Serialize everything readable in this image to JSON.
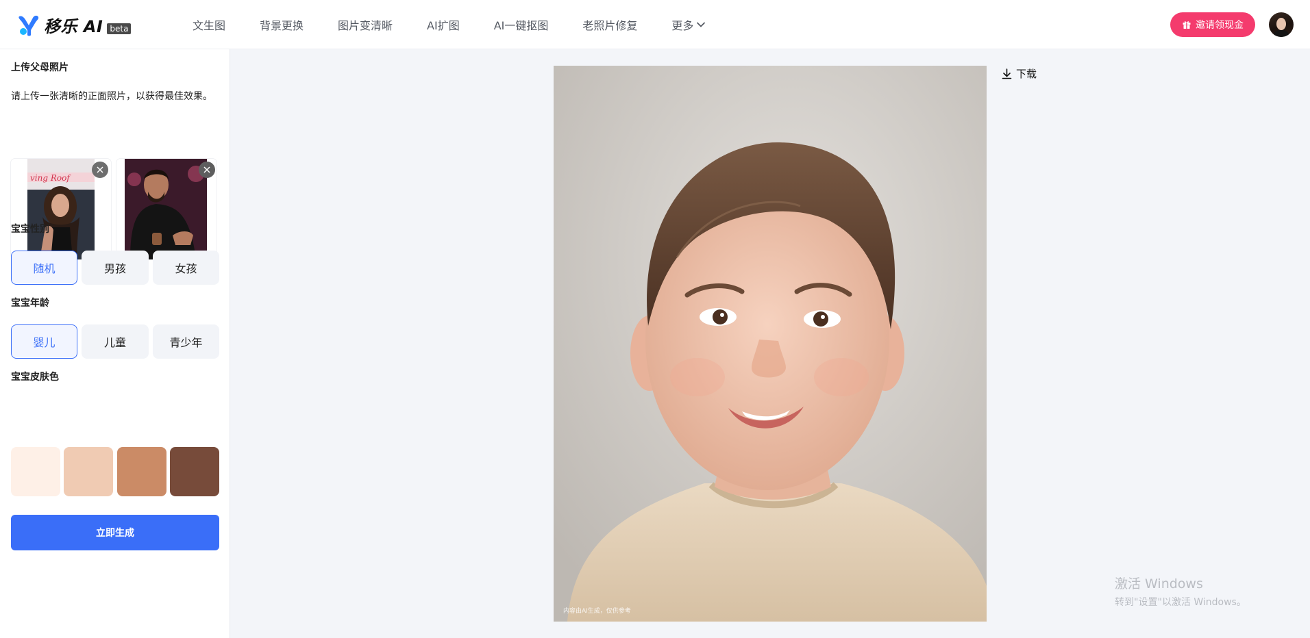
{
  "brand": {
    "name": "移乐 AI",
    "badge": "beta",
    "accent": "#3a6ef8",
    "invite_color": "#f43b6d"
  },
  "nav": {
    "items": [
      "文生图",
      "背景更换",
      "图片变清晰",
      "AI扩图",
      "AI一键抠图",
      "老照片修复"
    ],
    "more": "更多"
  },
  "header": {
    "invite_label": "邀请领现金",
    "avatar_icon": "user-avatar"
  },
  "panel": {
    "upload_title": "上传父母照片",
    "upload_hint": "请上传一张清晰的正面照片，以获得最佳效果。",
    "gender_title": "宝宝性别",
    "gender_options": [
      "随机",
      "男孩",
      "女孩"
    ],
    "gender_selected": "随机",
    "age_title": "宝宝年龄",
    "age_options": [
      "婴儿",
      "儿童",
      "青少年"
    ],
    "age_selected": "婴儿",
    "skin_title": "宝宝皮肤色",
    "skin_colors": [
      "#fef0e7",
      "#f0cbb3",
      "#cb8b66",
      "#774b3a"
    ],
    "generate_label": "立即生成"
  },
  "result": {
    "caption": "内容由AI生成，仅供参考",
    "download_label": "下载"
  },
  "watermark": {
    "line1": "激活 Windows",
    "line2": "转到\"设置\"以激活 Windows。"
  }
}
